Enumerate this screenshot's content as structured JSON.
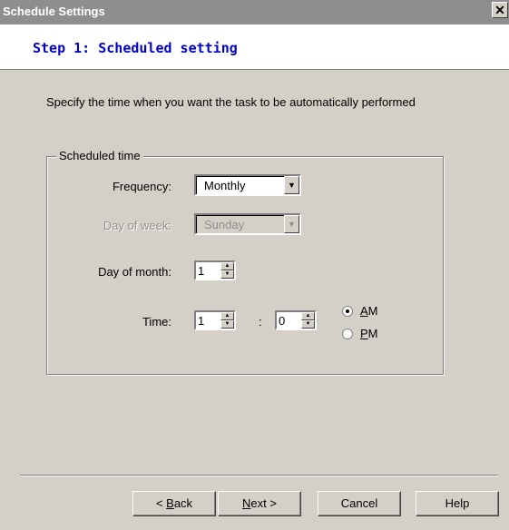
{
  "window": {
    "title": "Schedule Settings",
    "close_glyph": "✕"
  },
  "header": {
    "title": "Step 1: Scheduled setting"
  },
  "instruction": "Specify the time when you want the task to be automatically performed",
  "group": {
    "legend": "Scheduled time",
    "frequency": {
      "label": "Frequency:",
      "value": "Monthly"
    },
    "day_of_week": {
      "label": "Day of week:",
      "value": "Sunday",
      "disabled": true
    },
    "day_of_month": {
      "label": "Day of month:",
      "value": "1"
    },
    "time": {
      "label": "Time:",
      "hour": "1",
      "separator": ":",
      "minute": "0",
      "am_prefix": "",
      "am_accel": "A",
      "am_rest": "M",
      "pm_prefix": "",
      "pm_accel": "P",
      "pm_rest": "M",
      "selected": "AM"
    }
  },
  "buttons": {
    "back": {
      "prefix": "< ",
      "accel": "B",
      "rest": "ack"
    },
    "next": {
      "prefix": "",
      "accel": "N",
      "rest": "ext >"
    },
    "cancel": "Cancel",
    "help": "Help"
  },
  "icons": {
    "dropdown": "chevron-down-icon",
    "spin_up": "spin-up-icon",
    "spin_down": "spin-down-icon",
    "close": "close-icon"
  },
  "colors": {
    "title_bar": "#8e8e8e",
    "dialog_bg": "#d4d0c8",
    "header_title": "#0000c8",
    "disabled_text": "#8e8e8e"
  }
}
